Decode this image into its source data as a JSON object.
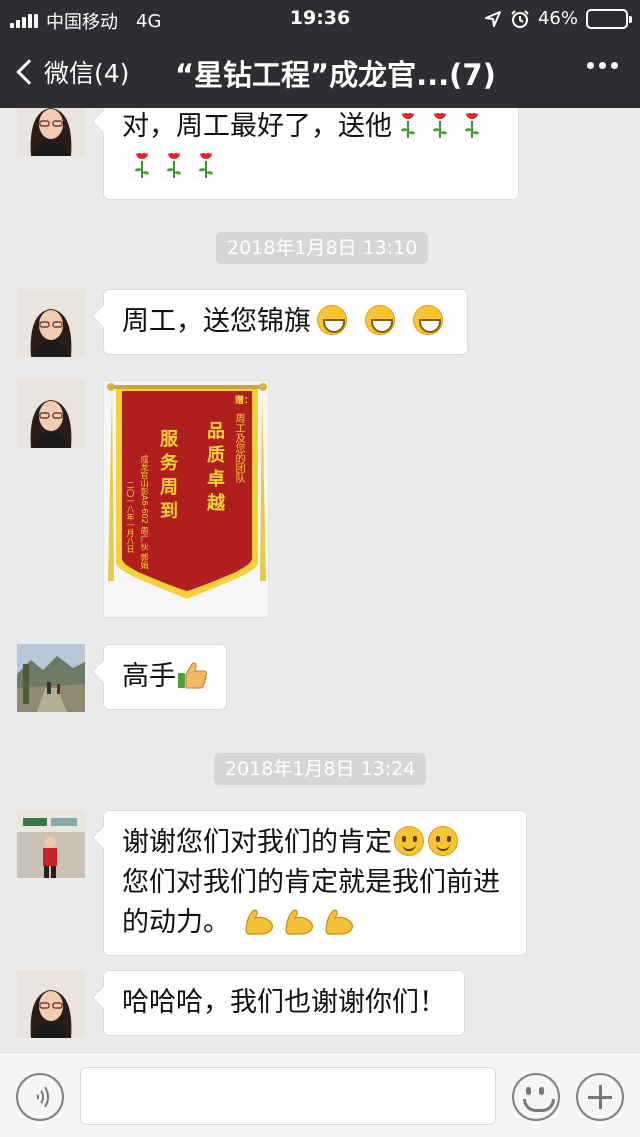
{
  "status_bar": {
    "carrier": "中国移动",
    "network": "4G",
    "time": "19:36",
    "battery_percent": "46%",
    "battery_level": 0.46
  },
  "nav": {
    "back_label": "微信(4)",
    "title": "“星钻工程”成龙官...(7)"
  },
  "messages": [
    {
      "type": "text",
      "line1": "对，周工最好了，送他",
      "rose_count": 6
    },
    {
      "type": "time",
      "text": "2018年1月8日 13:10"
    },
    {
      "type": "text",
      "text": "周工，送您锦旗",
      "emoji": "grin-squint-icon",
      "emoji_count": 3
    },
    {
      "type": "image",
      "banner": {
        "dedication_label": "赠：",
        "recipient": "周工及您的团队",
        "motto1": "品质卓越",
        "motto2": "服务周到",
        "sender": "成龙官山彭A6-602 周广伙 郭娟",
        "date": "二〇一八年一月八日"
      }
    },
    {
      "type": "text",
      "text": "高手",
      "emoji": "thumbs-up-icon"
    },
    {
      "type": "time",
      "text": "2018年1月8日 13:24"
    },
    {
      "type": "text",
      "line1": "谢谢您们对我们的肯定",
      "line2": "您们对我们的肯定就是我们前进",
      "line3": "的动力。",
      "emoji1": "smile-icon",
      "emoji2": "flexed-biceps-icon"
    },
    {
      "type": "text",
      "text": "哈哈哈，我们也谢谢你们！"
    }
  ],
  "colors": {
    "header": "#2e2e32",
    "chat_bg": "#ebebeb",
    "timestamp_bg": "#d6d6d6",
    "battery": "#4cd964",
    "banner_red": "#b01e1e",
    "banner_gold": "#f5d23c"
  }
}
